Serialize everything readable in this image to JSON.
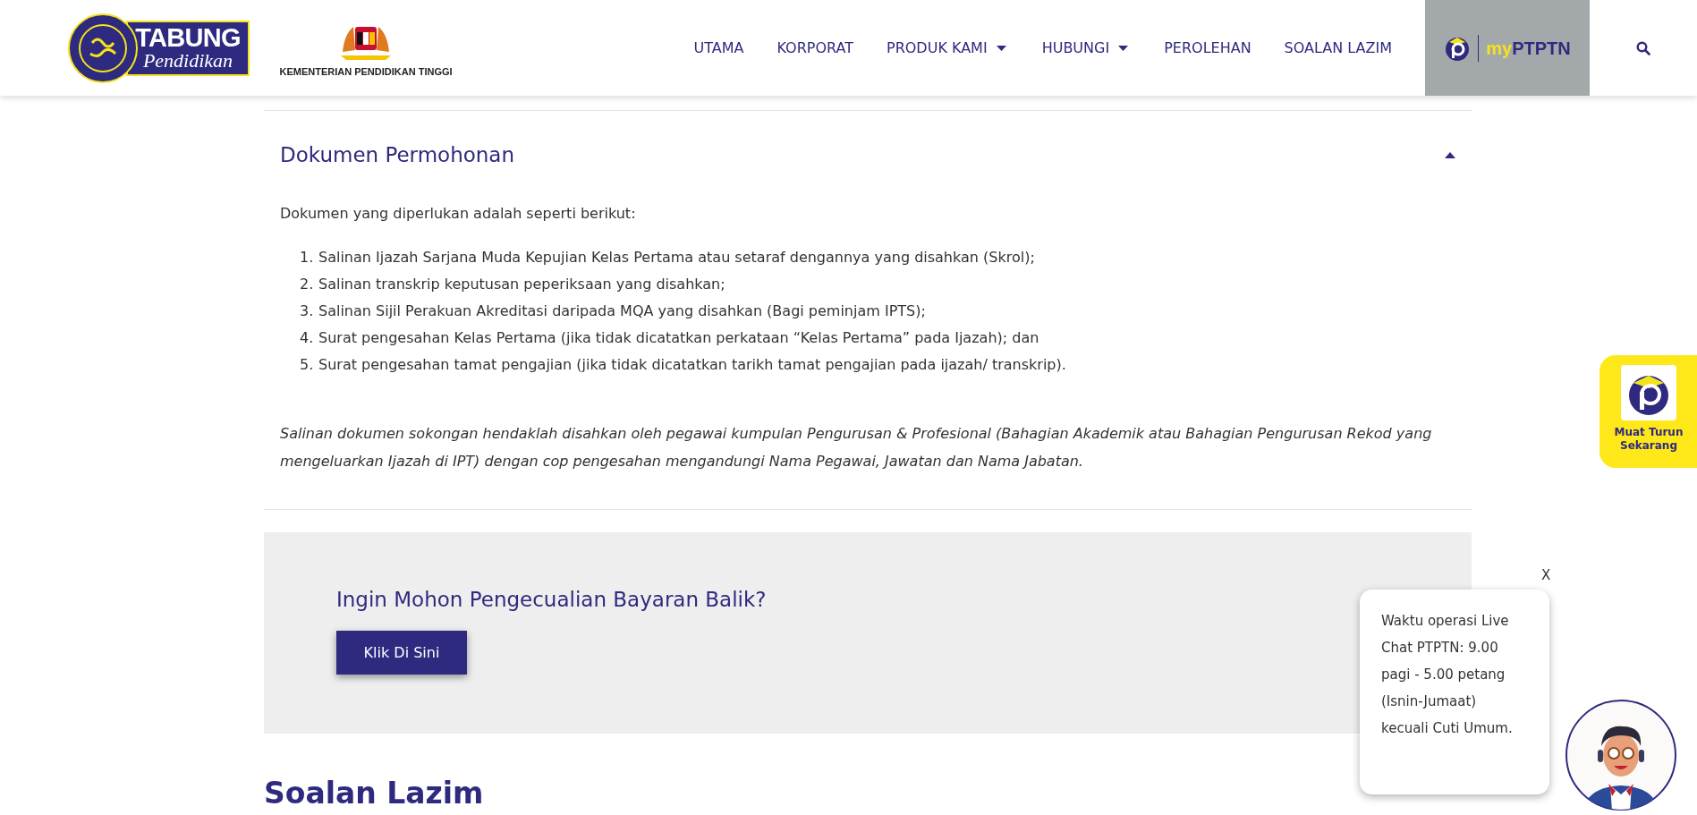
{
  "header": {
    "logo": {
      "title": "TABUNG",
      "subtitle": "Pendidikan"
    },
    "ministry": "KEMENTERIAN PENDIDIKAN TINGGI",
    "nav": [
      {
        "label": "UTAMA",
        "dropdown": false
      },
      {
        "label": "KORPORAT",
        "dropdown": false
      },
      {
        "label": "PRODUK KAMI",
        "dropdown": true
      },
      {
        "label": "HUBUNGI",
        "dropdown": true
      },
      {
        "label": "PEROLEHAN",
        "dropdown": false
      },
      {
        "label": "SOALAN LAZIM",
        "dropdown": false
      }
    ],
    "app_button": {
      "prefix": "my",
      "name": "PTPTN"
    }
  },
  "accordion": {
    "title": "Dokumen Permohonan",
    "expanded": true,
    "intro": "Dokumen yang diperlukan adalah seperti berikut:",
    "items": [
      {
        "number": "1.",
        "text": "Salinan Ijazah Sarjana Muda Kepujian Kelas Pertama atau setaraf dengannya yang disahkan (Skrol);"
      },
      {
        "number": "2.",
        "text": "Salinan transkrip keputusan peperiksaan yang disahkan;"
      },
      {
        "number": "3.",
        "text": "Salinan Sijil Perakuan Akreditasi daripada MQA yang disahkan (Bagi peminjam IPTS);"
      },
      {
        "number": "4.",
        "text": "Surat pengesahan Kelas Pertama (jika tidak dicatatkan perkataan “Kelas Pertama” pada Ijazah); dan"
      },
      {
        "number": "5.",
        "text": "Surat pengesahan tamat pengajian (jika tidak dicatatkan tarikh tamat pengajian pada ijazah/ transkrip)."
      }
    ],
    "note": "Salinan dokumen sokongan hendaklah disahkan oleh pegawai kumpulan Pengurusan & Profesional (Bahagian Akademik atau Bahagian Pengurusan Rekod yang mengeluarkan Ijazah di IPT) dengan cop pengesahan mengandungi Nama Pegawai, Jawatan dan Nama Jabatan."
  },
  "cta": {
    "title": "Ingin Mohon Pengecualian Bayaran Balik?",
    "button": "Klik Di Sini"
  },
  "section_heading": "Soalan Lazim",
  "download_widget": {
    "label": "Muat Turun Sekarang"
  },
  "chat": {
    "close": "X",
    "message": "Waktu operasi Live Chat PTPTN: 9.00 pagi - 5.00 petang (Isnin-Jumaat) kecuali Cuti Umum."
  }
}
